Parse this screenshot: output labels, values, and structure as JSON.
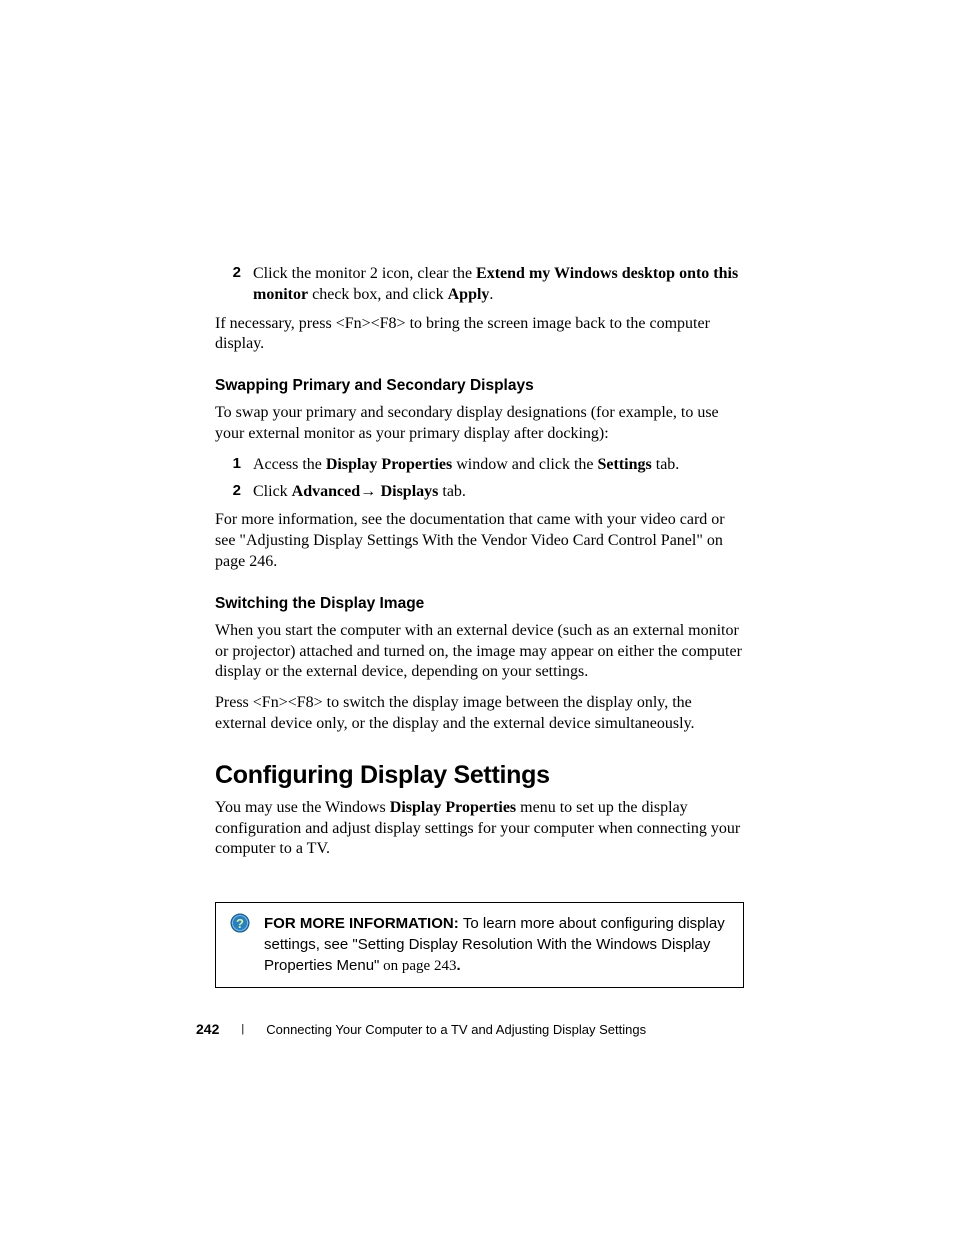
{
  "step2": {
    "num": "2",
    "pre": "Click the monitor 2 icon, clear the ",
    "bold1": "Extend my Windows desktop onto this monitor",
    "mid": " check box, and click ",
    "bold2": "Apply",
    "post": "."
  },
  "para_fnf8": "If necessary, press <Fn><F8> to bring the screen image back to the computer display.",
  "h3_swap": "Swapping Primary and Secondary Displays",
  "para_swap": "To swap your primary and secondary display designations (for example, to use your external monitor as your primary display after docking):",
  "swap_step1": {
    "num": "1",
    "pre": "Access the ",
    "bold1": "Display Properties",
    "mid": " window and click the ",
    "bold2": "Settings",
    "post": " tab."
  },
  "swap_step2": {
    "num": "2",
    "pre": "Click ",
    "bold1": "Advanced",
    "arrow": "→ ",
    "bold2": "Displays",
    "post": " tab."
  },
  "para_moreinfo": "For more information, see the documentation that came with your video card or see \"Adjusting Display Settings With the Vendor Video Card Control Panel\" on page 246.",
  "h3_switch": "Switching the Display Image",
  "para_switch1": "When you start the computer with an external device (such as an external monitor or projector) attached and turned on, the image may appear on either the computer display or the external device, depending on your settings.",
  "para_switch2": "Press <Fn><F8> to switch the display image between the display only, the external device only, or the display and the external device simultaneously.",
  "h2_config": "Configuring Display Settings",
  "para_config_pre": "You may use the Windows ",
  "para_config_bold": "Display Properties",
  "para_config_post": " menu to set up the display configuration and adjust display settings for your computer when connecting your computer to a TV.",
  "infobox": {
    "label": "FOR MORE INFORMATION: ",
    "body": "To learn more about configuring display settings, see \"Setting Display Resolution With the Windows Display Properties Menu\"",
    "tail": " on page 243",
    "dot": "."
  },
  "footer": {
    "page": "242",
    "title": "Connecting Your Computer to a TV and Adjusting Display Settings"
  }
}
